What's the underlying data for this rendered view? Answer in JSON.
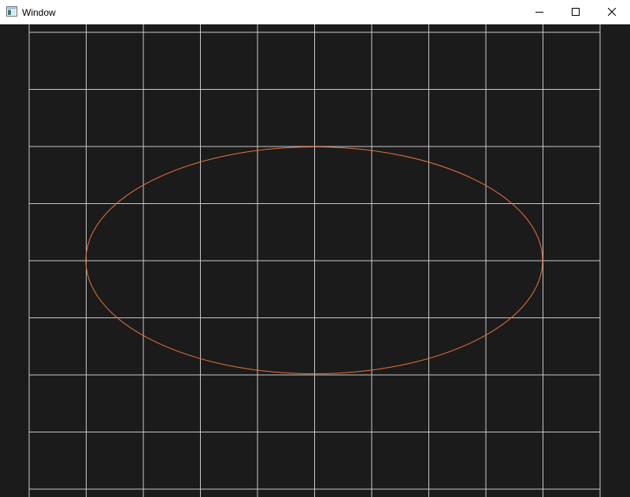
{
  "window": {
    "title": "Window",
    "icon": "app-window-icon",
    "controls": {
      "minimize_icon": "minimize-icon",
      "maximize_icon": "maximize-icon",
      "close_icon": "close-icon"
    }
  },
  "scene": {
    "background_color": "#1b1b1b",
    "grid_color": "#c8c8c8",
    "ellipse_color": "#e8733a",
    "shapes": [
      "grid",
      "ellipse"
    ]
  }
}
